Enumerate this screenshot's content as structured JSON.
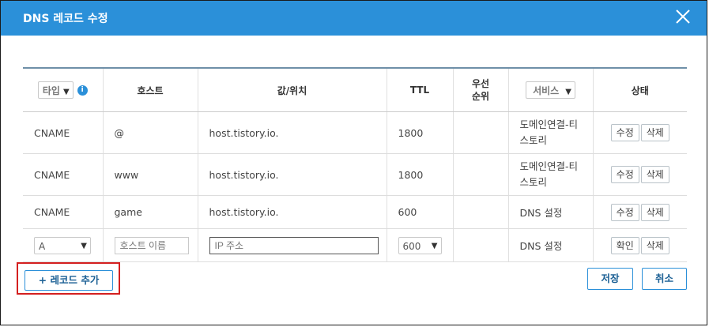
{
  "dialog": {
    "title": "DNS 레코드 수정",
    "close_icon": "close-icon",
    "accent_color": "#2b90d9",
    "highlight_color": "#d42020"
  },
  "table": {
    "headers": {
      "type_select": "타입",
      "host": "호스트",
      "value": "값/위치",
      "ttl": "TTL",
      "priority": "우선\n순위",
      "service_select": "서비스",
      "status": "상태"
    },
    "rows": [
      {
        "type": "CNAME",
        "host": "@",
        "value": "host.tistory.io.",
        "ttl": "1800",
        "priority": "",
        "service": "도메인연결-티스토리",
        "btn1": "수정",
        "btn2": "삭제"
      },
      {
        "type": "CNAME",
        "host": "www",
        "value": "host.tistory.io.",
        "ttl": "1800",
        "priority": "",
        "service": "도메인연결-티스토리",
        "btn1": "수정",
        "btn2": "삭제"
      },
      {
        "type": "CNAME",
        "host": "game",
        "value": "host.tistory.io.",
        "ttl": "600",
        "priority": "",
        "service": "DNS 설정",
        "btn1": "수정",
        "btn2": "삭제"
      }
    ],
    "new_row": {
      "type_selected": "A",
      "host_placeholder": "호스트 이름",
      "ip_placeholder": "IP 주소",
      "ttl_selected": "600",
      "service": "DNS 설정",
      "btn1": "확인",
      "btn2": "삭제"
    }
  },
  "footer": {
    "add_record": "+ 레코드 추가",
    "save": "저장",
    "cancel": "취소"
  }
}
